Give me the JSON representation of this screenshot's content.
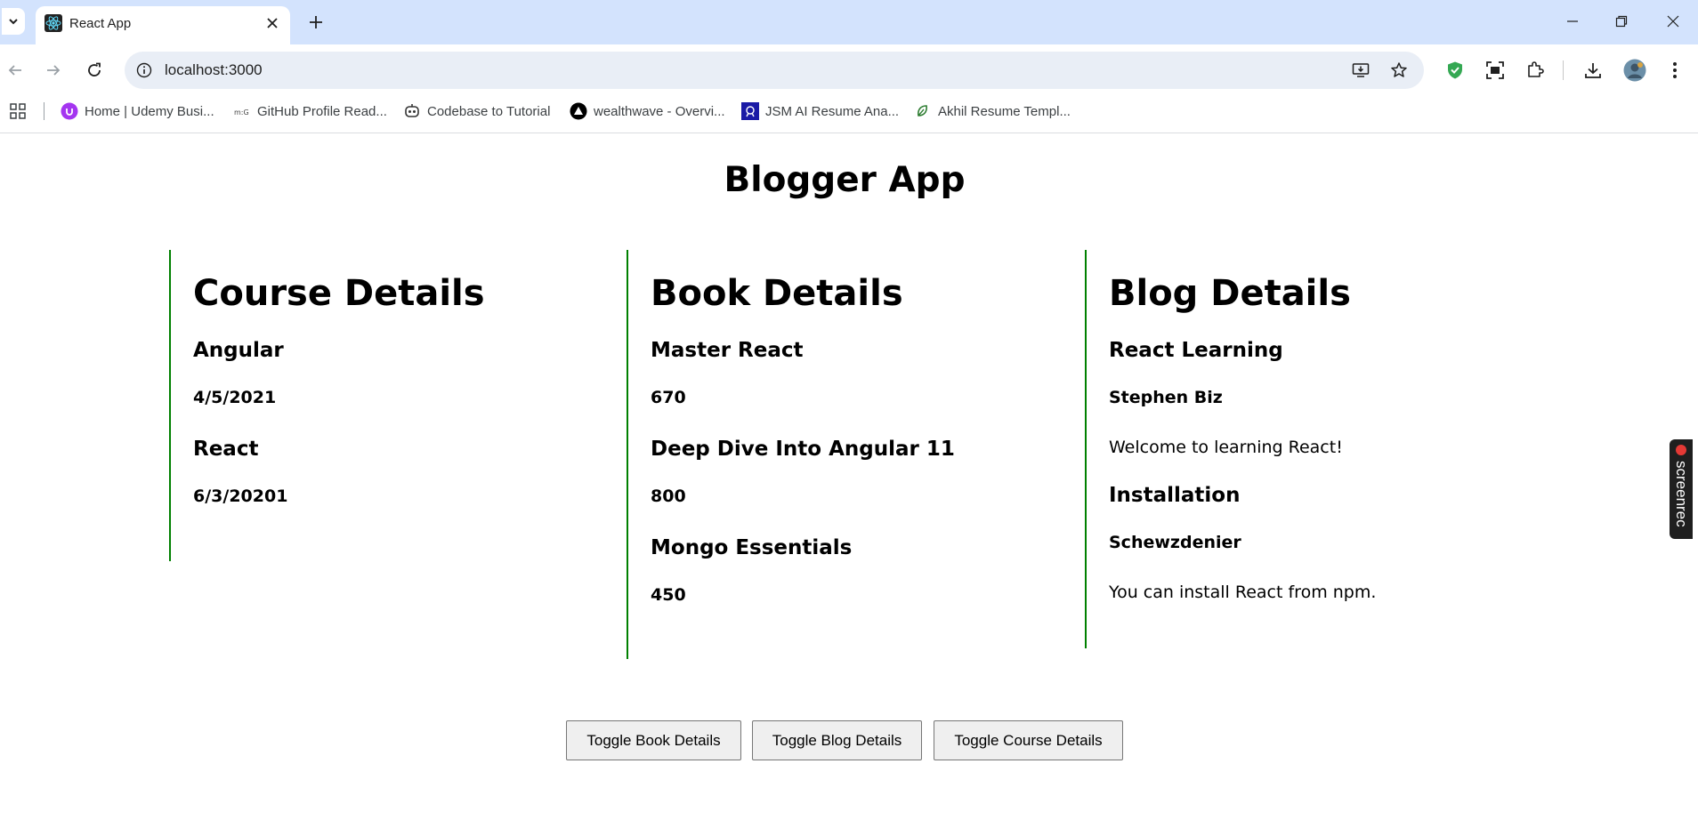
{
  "browser": {
    "tab_title": "React App",
    "url": "localhost:3000",
    "bookmarks": [
      {
        "label": "Home | Udemy Busi...",
        "icon": "udemy-icon"
      },
      {
        "label": "GitHub Profile Read...",
        "icon": "mdg-icon"
      },
      {
        "label": "Codebase to Tutorial",
        "icon": "robot-icon"
      },
      {
        "label": "wealthwave - Overvi...",
        "icon": "vercel-icon"
      },
      {
        "label": "JSM AI Resume Ana...",
        "icon": "jsm-icon"
      },
      {
        "label": "Akhil Resume Templ...",
        "icon": "leaf-icon"
      }
    ]
  },
  "page": {
    "title": "Blogger App",
    "course": {
      "heading": "Course Details",
      "items": [
        {
          "name": "Angular",
          "date": "4/5/2021"
        },
        {
          "name": "React",
          "date": "6/3/20201"
        }
      ]
    },
    "book": {
      "heading": "Book Details",
      "items": [
        {
          "name": "Master React",
          "price": "670"
        },
        {
          "name": "Deep Dive Into Angular 11",
          "price": "800"
        },
        {
          "name": "Mongo Essentials",
          "price": "450"
        }
      ]
    },
    "blog": {
      "heading": "Blog Details",
      "items": [
        {
          "title": "React Learning",
          "author": "Stephen Biz",
          "content": "Welcome to learning React!"
        },
        {
          "title": "Installation",
          "author": "Schewzdenier",
          "content": "You can install React from npm."
        }
      ]
    },
    "buttons": {
      "toggle_book": "Toggle Book Details",
      "toggle_blog": "Toggle Blog Details",
      "toggle_course": "Toggle Course Details"
    }
  },
  "overlay": {
    "screenrec_label": "screenrec"
  },
  "colors": {
    "panel_border": "#008000",
    "tabbar_bg": "#d3e3fd",
    "omnibox_bg": "#e9eef6"
  }
}
